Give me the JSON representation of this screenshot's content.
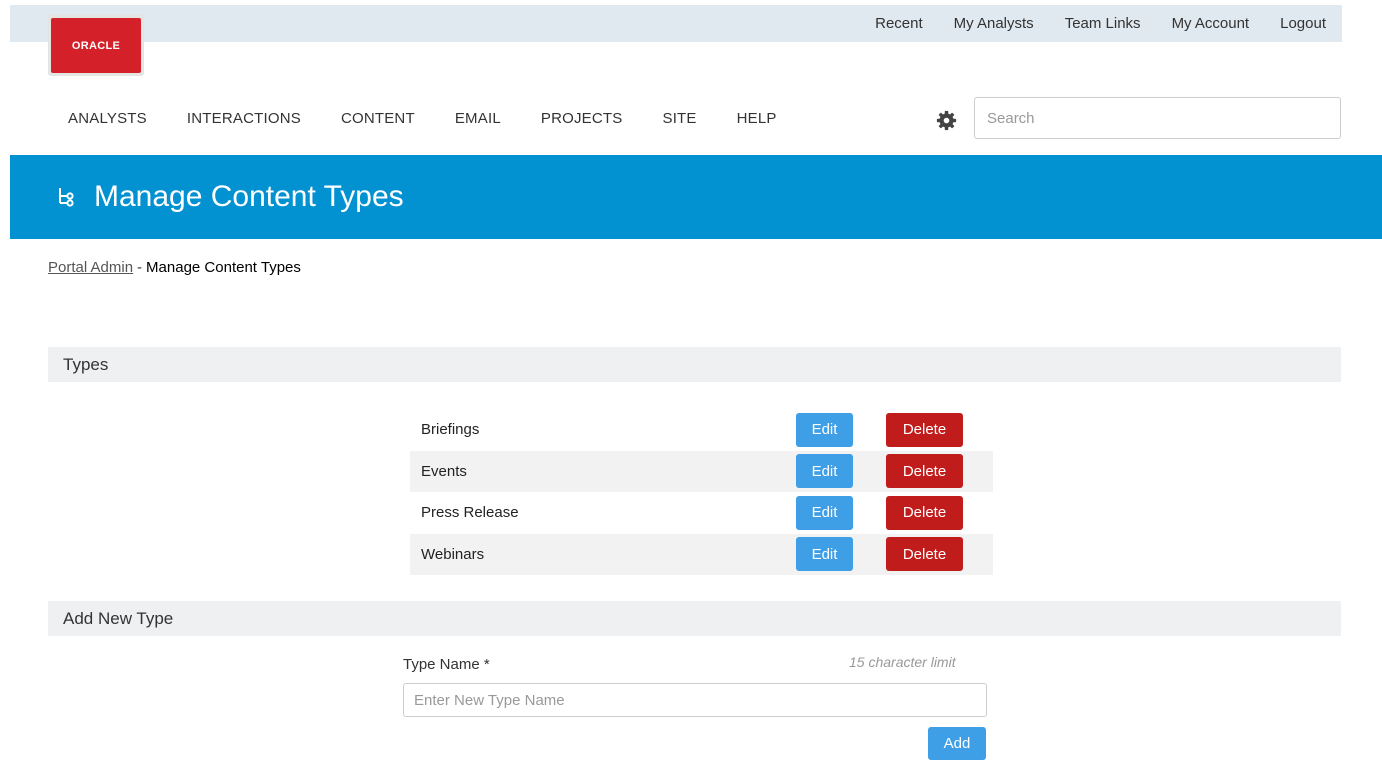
{
  "top_links": [
    "Recent",
    "My Analysts",
    "Team Links",
    "My Account",
    "Logout"
  ],
  "logo": {
    "text": "ORACLE",
    "color": "#d42028"
  },
  "main_nav": [
    "ANALYSTS",
    "INTERACTIONS",
    "CONTENT",
    "EMAIL",
    "PROJECTS",
    "SITE",
    "HELP"
  ],
  "search": {
    "placeholder": "Search",
    "value": ""
  },
  "icons": {
    "settings": "gear-icon",
    "banner": "hierarchy-icon"
  },
  "banner": {
    "title": "Manage Content Types",
    "color": "#0392d1"
  },
  "breadcrumb": {
    "parent": "Portal Admin",
    "separator": "-",
    "current": "Manage Content Types"
  },
  "types_section": {
    "heading": "Types",
    "items": [
      {
        "name": "Briefings",
        "edit_label": "Edit",
        "delete_label": "Delete"
      },
      {
        "name": "Events",
        "edit_label": "Edit",
        "delete_label": "Delete"
      },
      {
        "name": "Press Release",
        "edit_label": "Edit",
        "delete_label": "Delete"
      },
      {
        "name": "Webinars",
        "edit_label": "Edit",
        "delete_label": "Delete"
      }
    ]
  },
  "add_section": {
    "heading": "Add New Type",
    "field_label": "Type Name *",
    "char_limit": "15 character limit",
    "placeholder": "Enter New Type Name",
    "value": "",
    "add_label": "Add"
  },
  "colors": {
    "edit_button": "#3e9fe6",
    "delete_button": "#c11c1c",
    "topbar": "#e1e9f0"
  }
}
